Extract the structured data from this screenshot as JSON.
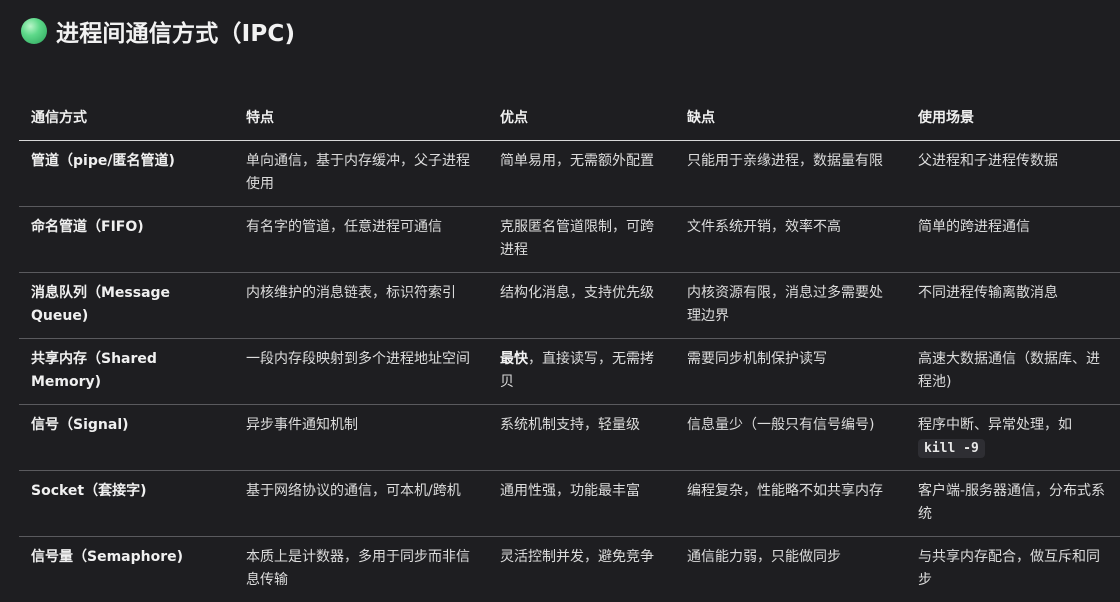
{
  "heading": {
    "title": "进程间通信方式（IPC)"
  },
  "table": {
    "headers": [
      "通信方式",
      "特点",
      "优点",
      "缺点",
      "使用场景"
    ],
    "rows": [
      {
        "method": "管道（pipe/匿名管道)",
        "feature": "单向通信，基于内存缓冲，父子进程使用",
        "pros_bold": "",
        "pros": "简单易用，无需额外配置",
        "cons": "只能用于亲缘进程，数据量有限",
        "scenario": "父进程和子进程传数据",
        "scenario_code": ""
      },
      {
        "method": "命名管道（FIFO)",
        "feature": "有名字的管道，任意进程可通信",
        "pros_bold": "",
        "pros": "克服匿名管道限制，可跨进程",
        "cons": "文件系统开销，效率不高",
        "scenario": "简单的跨进程通信",
        "scenario_code": ""
      },
      {
        "method": "消息队列（Message Queue)",
        "feature": "内核维护的消息链表，标识符索引",
        "pros_bold": "",
        "pros": "结构化消息，支持优先级",
        "cons": "内核资源有限，消息过多需要处理边界",
        "scenario": "不同进程传输离散消息",
        "scenario_code": ""
      },
      {
        "method": "共享内存（Shared Memory)",
        "feature": "一段内存段映射到多个进程地址空间",
        "pros_bold": "最快",
        "pros": "，直接读写，无需拷贝",
        "cons": "需要同步机制保护读写",
        "scenario": "高速大数据通信（数据库、进程池)",
        "scenario_code": ""
      },
      {
        "method": "信号（Signal)",
        "feature": "异步事件通知机制",
        "pros_bold": "",
        "pros": "系统机制支持，轻量级",
        "cons": "信息量少（一般只有信号编号)",
        "scenario": "程序中断、异常处理，如",
        "scenario_code": "kill -9"
      },
      {
        "method": "Socket（套接字)",
        "feature": "基于网络协议的通信，可本机/跨机",
        "pros_bold": "",
        "pros": "通用性强，功能最丰富",
        "cons": "编程复杂，性能略不如共享内存",
        "scenario": "客户端-服务器通信，分布式系统",
        "scenario_code": ""
      },
      {
        "method": "信号量（Semaphore)",
        "feature": "本质上是计数器，多用于同步而非信息传输",
        "pros_bold": "",
        "pros": "灵活控制并发，避免竞争",
        "cons": "通信能力弱，只能做同步",
        "scenario": "与共享内存配合，做互斥和同步",
        "scenario_code": ""
      }
    ]
  }
}
